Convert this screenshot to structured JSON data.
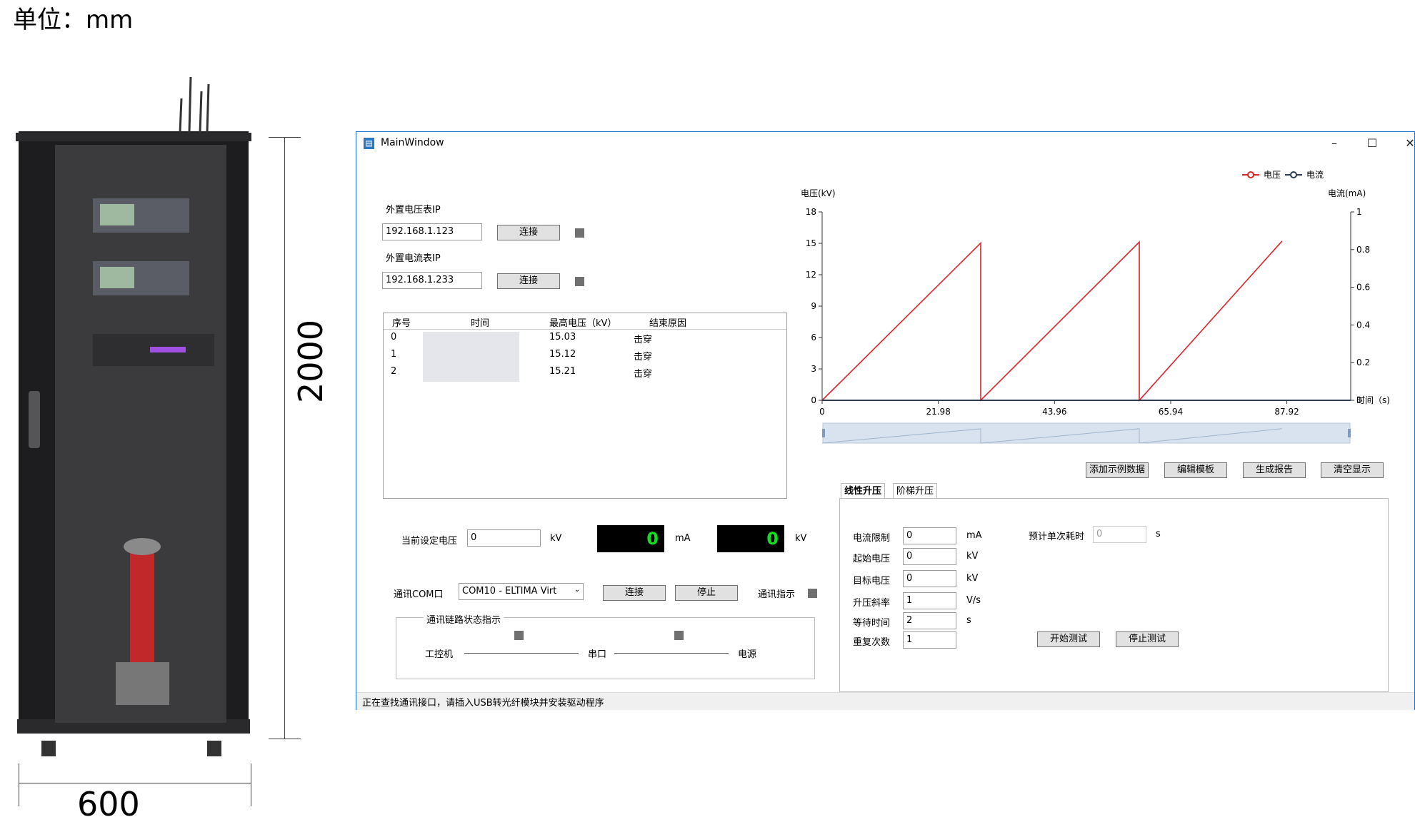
{
  "unit_label": "单位：mm",
  "dimensions": {
    "height": "2000",
    "width": "600"
  },
  "window": {
    "title": "MainWindow",
    "minimize": "–",
    "maximize": "☐",
    "close": "✕"
  },
  "ip": {
    "voltage_label": "外置电压表IP",
    "voltage_value": "192.168.1.123",
    "voltage_connect": "连接",
    "current_label": "外置电流表IP",
    "current_value": "192.168.1.233",
    "current_connect": "连接"
  },
  "table": {
    "headers": [
      "序号",
      "时间",
      "最高电压（kV）",
      "结束原因"
    ],
    "rows": [
      {
        "id": "0",
        "voltage": "15.03",
        "reason": "击穿"
      },
      {
        "id": "1",
        "voltage": "15.12",
        "reason": "击穿"
      },
      {
        "id": "2",
        "voltage": "15.21",
        "reason": "击穿"
      }
    ]
  },
  "setpoint": {
    "label": "当前设定电压",
    "value": "0",
    "unit": "kV",
    "current_display": "0",
    "current_unit": "mA",
    "voltage_display": "0",
    "voltage_unit": "kV"
  },
  "com": {
    "label": "通讯COM口",
    "selected": "COM10 - ELTIMA Virt",
    "connect": "连接",
    "stop": "停止",
    "indicator_label": "通讯指示"
  },
  "link": {
    "title": "通讯链路状态指示",
    "node1": "工控机",
    "node2": "串口",
    "node3": "电源"
  },
  "chart_actions": [
    "添加示例数据",
    "编辑模板",
    "生成报告",
    "清空显示"
  ],
  "tabs": [
    "线性升压",
    "阶梯升压"
  ],
  "params": {
    "current_limit_label": "电流限制",
    "current_limit_value": "0",
    "current_limit_unit": "mA",
    "start_voltage_label": "起始电压",
    "start_voltage_value": "0",
    "start_voltage_unit": "kV",
    "target_voltage_label": "目标电压",
    "target_voltage_value": "0",
    "target_voltage_unit": "kV",
    "ramp_label": "升压斜率",
    "ramp_value": "1",
    "ramp_unit": "V/s",
    "wait_label": "等待时间",
    "wait_value": "2",
    "wait_unit": "s",
    "repeat_label": "重复次数",
    "repeat_value": "1",
    "estimate_label": "预计单次耗时",
    "estimate_value": "0",
    "estimate_unit": "s",
    "start_test": "开始测试",
    "stop_test": "停止测试"
  },
  "status": "正在查找通讯接口，请插入USB转光纤模块并安装驱动程序",
  "colors": {
    "voltage": "#d9262b",
    "current": "#2c3e50",
    "accent": "#1a73c8"
  },
  "chart_data": {
    "type": "line",
    "left_axis_label": "电压(kV)",
    "right_axis_label": "电流(mA)",
    "x_axis_label": "时间（s)",
    "legend": [
      "电压",
      "电流"
    ],
    "ylim": [
      0,
      18
    ],
    "y2lim": [
      0,
      1
    ],
    "xlim": [
      0,
      100
    ],
    "y_ticks": [
      "0",
      "3",
      "6",
      "9",
      "12",
      "15",
      "18"
    ],
    "y2_ticks": [
      "0",
      "0.2",
      "0.4",
      "0.6",
      "0.8",
      "1"
    ],
    "x_ticks": [
      "0",
      "21.98",
      "43.96",
      "65.94",
      "87.92"
    ],
    "series": [
      {
        "name": "电压",
        "x": [
          0,
          30,
          30,
          60,
          60,
          87
        ],
        "y": [
          0,
          15.03,
          0,
          15.12,
          0,
          15.21
        ]
      },
      {
        "name": "电流",
        "x": [
          0,
          100
        ],
        "y": [
          0,
          0
        ]
      }
    ]
  }
}
